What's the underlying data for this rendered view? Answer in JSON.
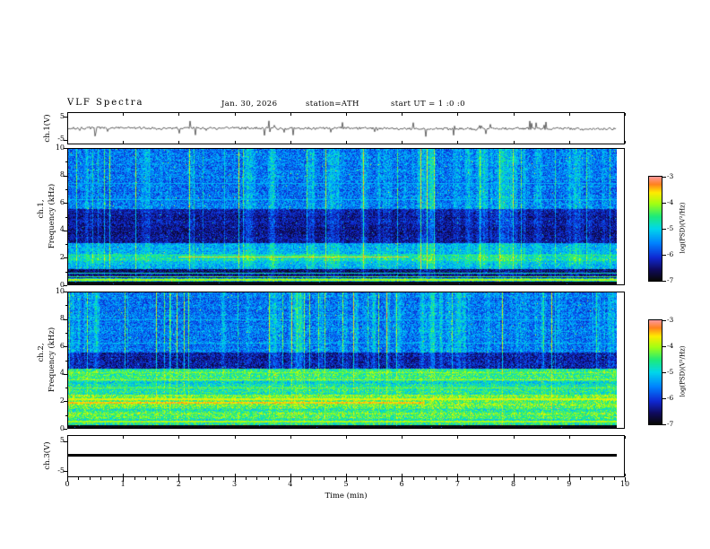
{
  "header": {
    "title": "VLF  Spectra",
    "date": "Jan. 30, 2026",
    "station": "station=ATH",
    "start_ut": "start UT =  1 :0 :0"
  },
  "xaxis": {
    "label": "Time  (min)",
    "tick_labels": [
      "0",
      "1",
      "2",
      "3",
      "4",
      "5",
      "6",
      "7",
      "8",
      "9",
      "10"
    ],
    "min": 0,
    "max": 10
  },
  "panels": {
    "wave1": {
      "ylabel": "ch.1(V)",
      "ytick_labels": [
        "5",
        "-5"
      ]
    },
    "spec1": {
      "ylabel_line1": "ch.1,",
      "ylabel_line2": "Frequency (kHz)",
      "ytick_labels": [
        "10",
        "8",
        "6",
        "4",
        "2",
        "0"
      ]
    },
    "spec2": {
      "ylabel_line1": "ch.2,",
      "ylabel_line2": "Frequency (kHz)",
      "ytick_labels": [
        "10",
        "8",
        "6",
        "4",
        "2",
        "0"
      ]
    },
    "wave3": {
      "ylabel": "ch.3(V)",
      "ytick_labels": [
        "5",
        "-5"
      ]
    }
  },
  "colorbar": {
    "label": "log(PSD)(V²/Hz)",
    "tick_labels": [
      "-3",
      "-4",
      "-5",
      "-6",
      "-7"
    ],
    "min": -7,
    "max": -3
  },
  "chart_data": [
    {
      "type": "line",
      "panel": "ch1_waveform",
      "ylabel": "ch.1(V)",
      "ylim": [
        -7,
        7
      ],
      "ytick_values": [
        5,
        -5
      ],
      "xlim_min": [
        0,
        10
      ],
      "summary": "zero-mean broadband noise, typical amplitude about ±1 V, with frequent impulsive sferic spikes reaching roughly ±4 V across the full 10 minutes",
      "render": {
        "seed": 7,
        "noise_amp": 0.55,
        "spike_prob": 0.05,
        "spike_amp": 2.6
      }
    },
    {
      "type": "heatmap",
      "panel": "ch1_spectrogram",
      "ylabel": "ch.1, Frequency (kHz)",
      "ylim": [
        0,
        10
      ],
      "xlim": [
        0,
        10
      ],
      "value_label": "log(PSD)(V²/Hz)",
      "value_range": [
        -7,
        -3
      ],
      "summary": "blue/cyan background PSD near -5.7 with dense vertical sferic streaks up to -3.5; quieter dark-blue band 3-5.5 kHz near -6.4; cyan/green 1-3 kHz; near-black strip below 0.25 kHz; intermittent red interference line near 2 kHz (approx. minutes 2-6); several thin horizontal interference lines",
      "render": {
        "seed": 21,
        "bands": [
          {
            "f0": -1,
            "f1": 0.22,
            "v": -7.0,
            "nz": 0.15,
            "st": 0.0,
            "rn": 0.0
          },
          {
            "f0": 0.22,
            "f1": 0.5,
            "v": -5.2,
            "nz": 0.8,
            "st": 0.2,
            "rn": 0.4
          },
          {
            "f0": 0.5,
            "f1": 1.15,
            "v": -6.5,
            "nz": 0.5,
            "st": 0.25,
            "rn": 0.3
          },
          {
            "f0": 1.15,
            "f1": 1.75,
            "v": -5.3,
            "nz": 0.5,
            "st": 0.45,
            "rn": 0.25
          },
          {
            "f0": 1.75,
            "f1": 2.3,
            "v": -5.0,
            "nz": 0.55,
            "st": 0.5,
            "rn": 0.25
          },
          {
            "f0": 2.3,
            "f1": 3.1,
            "v": -5.4,
            "nz": 0.5,
            "st": 0.5,
            "rn": 0.2
          },
          {
            "f0": 3.1,
            "f1": 5.6,
            "v": -6.35,
            "nz": 0.45,
            "st": 0.55,
            "rn": 0.15
          },
          {
            "f0": 5.6,
            "f1": 10.1,
            "v": -5.65,
            "nz": 0.55,
            "st": 0.65,
            "rn": 0.12
          }
        ],
        "lines": [
          {
            "f": 0.35,
            "v": -4.0,
            "w": 0.05
          },
          {
            "f": 0.6,
            "v": -4.4,
            "w": 0.04
          },
          {
            "f": 0.85,
            "v": -4.8,
            "w": 0.04
          },
          {
            "f": 1.0,
            "v": -6.9,
            "w": 0.05
          },
          {
            "f": 2.05,
            "v": -3.6,
            "w": 0.06,
            "x0": 2.0,
            "x1": 6.2
          },
          {
            "f": 2.2,
            "v": -4.6,
            "w": 0.04
          },
          {
            "f": 3.3,
            "v": -6.8,
            "w": 0.04
          },
          {
            "f": 4.0,
            "v": -6.9,
            "w": 0.04
          },
          {
            "f": 4.6,
            "v": -6.8,
            "w": 0.04
          },
          {
            "f": 5.0,
            "v": -6.9,
            "w": 0.04
          },
          {
            "f": 6.3,
            "v": -5.2,
            "w": 0.04
          },
          {
            "f": 7.5,
            "v": -5.3,
            "w": 0.04
          }
        ]
      }
    },
    {
      "type": "heatmap",
      "panel": "ch2_spectrogram",
      "ylabel": "ch.2, Frequency (kHz)",
      "ylim": [
        0,
        10
      ],
      "xlim": [
        0,
        10
      ],
      "value_label": "log(PSD)(V²/Hz)",
      "value_range": [
        -7,
        -3
      ],
      "summary": "upper half (5.5-10 kHz) blue near -5.7 with vertical sferic streaks; quiet dark band 4.4-5.6 kHz near -6.3; lower half (0.25-4.4 kHz) bright green/yellow horizontal banding near -4.5 with red interference lines near 1.9-2.2 kHz; near-black strip below 0.25 kHz",
      "render": {
        "seed": 31,
        "bands": [
          {
            "f0": -1,
            "f1": 0.22,
            "v": -7.0,
            "nz": 0.15,
            "st": 0.0,
            "rn": 0.0
          },
          {
            "f0": 0.22,
            "f1": 1.6,
            "v": -4.6,
            "nz": 0.6,
            "st": 0.15,
            "rn": 0.45
          },
          {
            "f0": 1.6,
            "f1": 2.5,
            "v": -4.4,
            "nz": 0.6,
            "st": 0.15,
            "rn": 0.4
          },
          {
            "f0": 2.5,
            "f1": 4.4,
            "v": -4.8,
            "nz": 0.6,
            "st": 0.2,
            "rn": 0.4
          },
          {
            "f0": 4.4,
            "f1": 5.6,
            "v": -6.3,
            "nz": 0.5,
            "st": 0.5,
            "rn": 0.2
          },
          {
            "f0": 5.6,
            "f1": 10.1,
            "v": -5.65,
            "nz": 0.55,
            "st": 0.65,
            "rn": 0.12
          }
        ],
        "lines": [
          {
            "f": 0.5,
            "v": -4.0,
            "w": 0.05
          },
          {
            "f": 0.9,
            "v": -6.5,
            "w": 0.04
          },
          {
            "f": 1.9,
            "v": -3.5,
            "w": 0.07,
            "x0": 0,
            "x1": 6.5
          },
          {
            "f": 2.15,
            "v": -3.8,
            "w": 0.05
          },
          {
            "f": 3.0,
            "v": -4.2,
            "w": 0.04
          },
          {
            "f": 3.6,
            "v": -4.1,
            "w": 0.04
          },
          {
            "f": 4.1,
            "v": -4.3,
            "w": 0.04
          },
          {
            "f": 5.0,
            "v": -6.9,
            "w": 0.05
          },
          {
            "f": 6.3,
            "v": -5.2,
            "w": 0.04
          },
          {
            "f": 8.0,
            "v": -5.3,
            "w": 0.03
          }
        ]
      }
    },
    {
      "type": "line",
      "panel": "ch3_waveform",
      "ylabel": "ch.3(V)",
      "ylim": [
        -7,
        7
      ],
      "ytick_values": [
        5,
        -5
      ],
      "summary": "constant 0 V — thick flat black line across the whole record (channel inactive)",
      "render": {
        "flat": true,
        "value": 0
      }
    }
  ]
}
